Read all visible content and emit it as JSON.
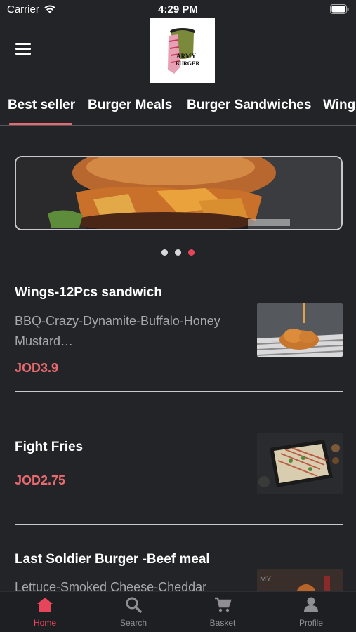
{
  "status": {
    "carrier": "Carrier",
    "time": "4:29 PM"
  },
  "header": {
    "logo_text_1": "ARMY",
    "logo_text_2": "BURGER"
  },
  "tabs": [
    {
      "label": "Best seller",
      "active": true
    },
    {
      "label": "Burger Meals"
    },
    {
      "label": "Burger Sandwiches"
    },
    {
      "label": "Wings"
    }
  ],
  "carousel": {
    "slide_count": 3,
    "active_index": 2
  },
  "products": [
    {
      "name": "Wings-12Pcs sandwich",
      "description": "BBQ-Crazy-Dynamite-Buffalo-Honey Mustard…",
      "price": "JOD3.9"
    },
    {
      "name": "Fight Fries",
      "description": "",
      "price": "JOD2.75"
    },
    {
      "name": "Last Soldier Burger -Beef meal",
      "description": "Lettuce-Smoked Cheese-Cheddar",
      "price": ""
    }
  ],
  "tabbar": [
    {
      "label": "Home",
      "icon": "home-icon",
      "active": true
    },
    {
      "label": "Search",
      "icon": "search-icon"
    },
    {
      "label": "Basket",
      "icon": "cart-icon"
    },
    {
      "label": "Profile",
      "icon": "profile-icon"
    }
  ],
  "colors": {
    "accent": "#e86a6f",
    "active_tab": "#e6455a",
    "background": "#232428"
  }
}
